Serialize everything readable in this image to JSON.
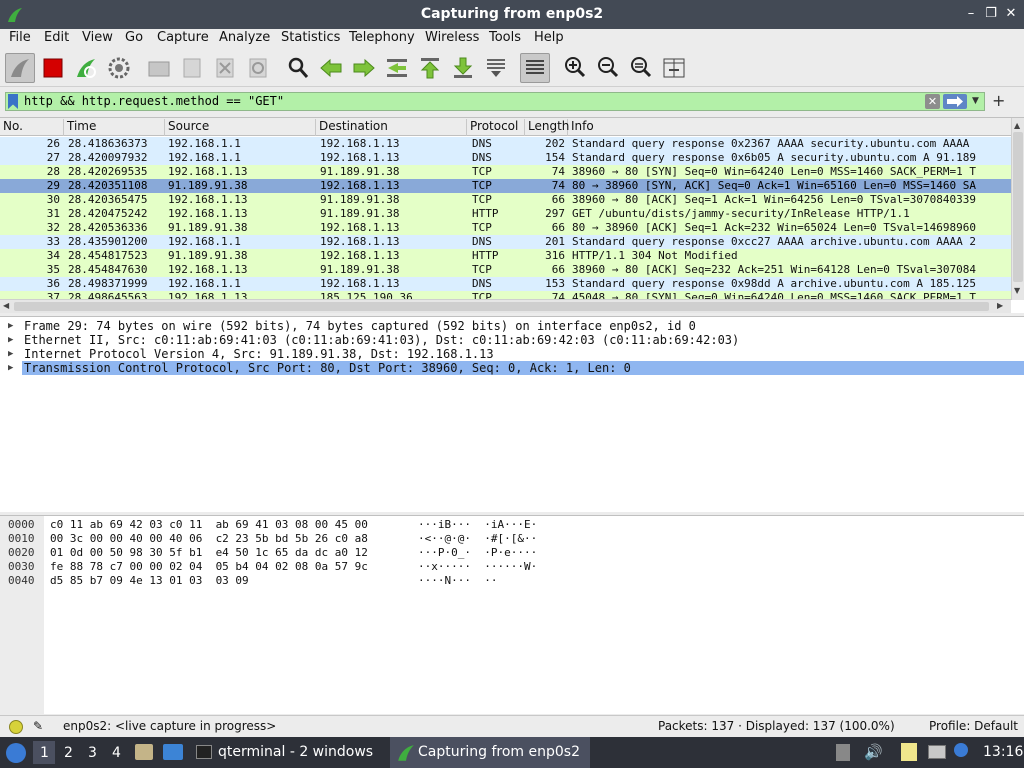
{
  "window": {
    "title": "Capturing from enp0s2",
    "minimize": "–",
    "maximize": "❐",
    "close": "✕"
  },
  "menu": [
    "File",
    "Edit",
    "View",
    "Go",
    "Capture",
    "Analyze",
    "Statistics",
    "Telephony",
    "Wireless",
    "Tools",
    "Help"
  ],
  "toolbar": {
    "icons": [
      "shark-fin-icon",
      "stop-icon",
      "restart-icon",
      "options-gear-icon",
      "open-folder-icon",
      "save-icon",
      "close-file-icon",
      "reload-icon",
      "search-icon",
      "back-arrow-icon",
      "forward-arrow-icon",
      "go-to-packet-icon",
      "first-packet-icon",
      "last-packet-icon",
      "autoscroll-icon",
      "colorize-icon",
      "zoom-in-icon",
      "zoom-out-icon",
      "normal-size-icon",
      "resize-columns-icon"
    ]
  },
  "filter": {
    "value": "http && http.request.method == \"GET\"",
    "add_label": "+",
    "accent": "#b3f0a8"
  },
  "packet_list": {
    "columns": [
      "No.",
      "Time",
      "Source",
      "Destination",
      "Protocol",
      "Length",
      "Info"
    ],
    "rows": [
      {
        "no": "26",
        "time": "28.418636373",
        "src": "192.168.1.1",
        "dst": "192.168.1.13",
        "proto": "DNS",
        "len": "202",
        "info": "Standard query response 0x2367 AAAA security.ubuntu.com AAAA",
        "kind": "dns"
      },
      {
        "no": "27",
        "time": "28.420097932",
        "src": "192.168.1.1",
        "dst": "192.168.1.13",
        "proto": "DNS",
        "len": "154",
        "info": "Standard query response 0x6b05 A security.ubuntu.com A 91.189",
        "kind": "dns"
      },
      {
        "no": "28",
        "time": "28.420269535",
        "src": "192.168.1.13",
        "dst": "91.189.91.38",
        "proto": "TCP",
        "len": "74",
        "info": "38960 → 80 [SYN] Seq=0 Win=64240 Len=0 MSS=1460 SACK_PERM=1 T",
        "kind": "tcpsyn"
      },
      {
        "no": "29",
        "time": "28.420351108",
        "src": "91.189.91.38",
        "dst": "192.168.1.13",
        "proto": "TCP",
        "len": "74",
        "info": "80 → 38960 [SYN, ACK] Seq=0 Ack=1 Win=65160 Len=0 MSS=1460 SA",
        "kind": "sel"
      },
      {
        "no": "30",
        "time": "28.420365475",
        "src": "192.168.1.13",
        "dst": "91.189.91.38",
        "proto": "TCP",
        "len": "66",
        "info": "38960 → 80 [ACK] Seq=1 Ack=1 Win=64256 Len=0 TSval=3070840339",
        "kind": "tcpsyn"
      },
      {
        "no": "31",
        "time": "28.420475242",
        "src": "192.168.1.13",
        "dst": "91.189.91.38",
        "proto": "HTTP",
        "len": "297",
        "info": "GET /ubuntu/dists/jammy-security/InRelease HTTP/1.1",
        "kind": "http"
      },
      {
        "no": "32",
        "time": "28.420536336",
        "src": "91.189.91.38",
        "dst": "192.168.1.13",
        "proto": "TCP",
        "len": "66",
        "info": "80 → 38960 [ACK] Seq=1 Ack=232 Win=65024 Len=0 TSval=14698960",
        "kind": "tcpsyn"
      },
      {
        "no": "33",
        "time": "28.435901200",
        "src": "192.168.1.1",
        "dst": "192.168.1.13",
        "proto": "DNS",
        "len": "201",
        "info": "Standard query response 0xcc27 AAAA archive.ubuntu.com AAAA 2",
        "kind": "dns"
      },
      {
        "no": "34",
        "time": "28.454817523",
        "src": "91.189.91.38",
        "dst": "192.168.1.13",
        "proto": "HTTP",
        "len": "316",
        "info": "HTTP/1.1 304 Not Modified",
        "kind": "http"
      },
      {
        "no": "35",
        "time": "28.454847630",
        "src": "192.168.1.13",
        "dst": "91.189.91.38",
        "proto": "TCP",
        "len": "66",
        "info": "38960 → 80 [ACK] Seq=232 Ack=251 Win=64128 Len=0 TSval=307084",
        "kind": "tcpsyn"
      },
      {
        "no": "36",
        "time": "28.498371999",
        "src": "192.168.1.1",
        "dst": "192.168.1.13",
        "proto": "DNS",
        "len": "153",
        "info": "Standard query response 0x98dd A archive.ubuntu.com A 185.125",
        "kind": "dns"
      },
      {
        "no": "37",
        "time": "28.498645563",
        "src": "192.168.1.13",
        "dst": "185.125.190.36",
        "proto": "TCP",
        "len": "74",
        "info": "45048 → 80 [SYN] Seq=0 Win=64240 Len=0 MSS=1460 SACK_PERM=1 T",
        "kind": "tcpsyn"
      }
    ]
  },
  "details": [
    {
      "text": "Frame 29: 74 bytes on wire (592 bits), 74 bytes captured (592 bits) on interface enp0s2, id 0",
      "selected": false
    },
    {
      "text": "Ethernet II, Src: c0:11:ab:69:41:03 (c0:11:ab:69:41:03), Dst: c0:11:ab:69:42:03 (c0:11:ab:69:42:03)",
      "selected": false
    },
    {
      "text": "Internet Protocol Version 4, Src: 91.189.91.38, Dst: 192.168.1.13",
      "selected": false
    },
    {
      "text": "Transmission Control Protocol, Src Port: 80, Dst Port: 38960, Seq: 0, Ack: 1, Len: 0",
      "selected": true
    }
  ],
  "hex": [
    {
      "off": "0000",
      "bytes": "c0 11 ab 69 42 03 c0 11  ab 69 41 03 08 00 45 00",
      "ascii": "···iB···  ·iA···E·"
    },
    {
      "off": "0010",
      "bytes": "00 3c 00 00 40 00 40 06  c2 23 5b bd 5b 26 c0 a8",
      "ascii": "·<··@·@·  ·#[·[&··"
    },
    {
      "off": "0020",
      "bytes": "01 0d 00 50 98 30 5f b1  e4 50 1c 65 da dc a0 12",
      "ascii": "···P·0_·  ·P·e····"
    },
    {
      "off": "0030",
      "bytes": "fe 88 78 c7 00 00 02 04  05 b4 04 02 08 0a 57 9c",
      "ascii": "··x·····  ······W·"
    },
    {
      "off": "0040",
      "bytes": "d5 85 b7 09 4e 13 01 03  03 09",
      "ascii": "····N···  ··"
    }
  ],
  "status": {
    "interface": "enp0s2: <live capture in progress>",
    "packets": "Packets: 137 · Displayed: 137 (100.0%)",
    "profile": "Profile: Default"
  },
  "taskbar": {
    "workspaces": [
      "1",
      "2",
      "3",
      "4"
    ],
    "terminal_task": "qterminal - 2 windows",
    "wireshark_task": "Capturing from enp0s2",
    "clock": "13:16"
  }
}
